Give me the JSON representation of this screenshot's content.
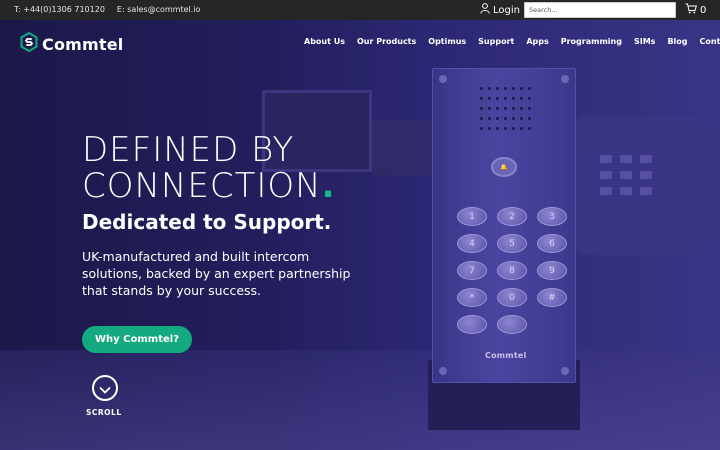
{
  "topbar": {
    "phone": "T: +44(0)1306 710120",
    "email": "E: sales@commtel.io",
    "login_label": "Login",
    "search_placeholder": "Search...",
    "cart_count": "0"
  },
  "brand": {
    "name": "Commtel",
    "accent_color": "#15a981",
    "logo_icon": "hexagon-s-logo-icon"
  },
  "nav": {
    "items": [
      "About Us",
      "Our Products",
      "Optimus",
      "Support",
      "Apps",
      "Programming",
      "SIMs",
      "Blog",
      "Contact"
    ]
  },
  "hero": {
    "headline_line1": "DEFINED BY",
    "headline_line2": "CONNECTION",
    "headline_dot": ".",
    "subheadline": "Dedicated to Support.",
    "description": "UK-manufactured and built intercom solutions, backed by an expert partnership that stands by your success.",
    "cta_label": "Why Commtel?",
    "scroll_label": "SCROLL"
  },
  "intercom": {
    "call_button_label": "🔔",
    "keys": [
      "1",
      "2",
      "3",
      "4",
      "5",
      "6",
      "7",
      "8",
      "9",
      "*",
      "0",
      "#",
      "",
      ""
    ],
    "brand_label": "Commtel"
  },
  "icons": {
    "login": "user-icon",
    "cart": "cart-icon",
    "scroll": "chevron-down-icon"
  }
}
